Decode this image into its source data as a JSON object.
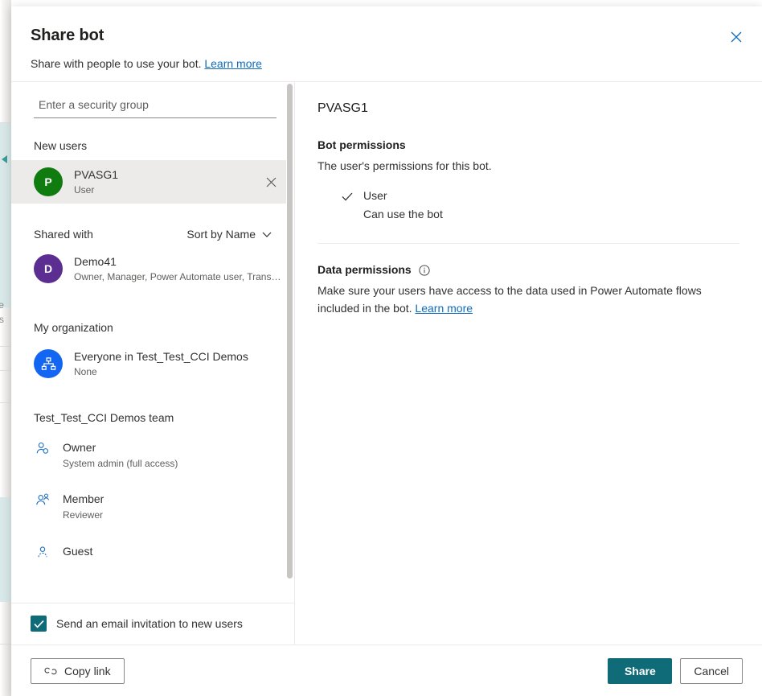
{
  "background": {
    "fragment_1": "se",
    "fragment_2": "es"
  },
  "dialog": {
    "title": "Share bot",
    "subtitle_text": "Share with people to use your bot.",
    "subtitle_link": "Learn more",
    "close_icon": "close-icon"
  },
  "left_pane": {
    "search": {
      "placeholder": "Enter a security group",
      "value": ""
    },
    "new_users": {
      "label": "New users",
      "people": [
        {
          "initial": "P",
          "name": "PVASG1",
          "sub": "User",
          "avatar_color": "#107C10",
          "selected": true,
          "remove_icon": "close-icon"
        }
      ]
    },
    "shared_with": {
      "label": "Shared with",
      "sort_label": "Sort by Name",
      "sort_icon": "chevron-down-icon",
      "people": [
        {
          "initial": "D",
          "name": "Demo41",
          "sub": "Owner, Manager, Power Automate user, Transc...",
          "avatar_color": "#5C2E91",
          "selected": false
        }
      ]
    },
    "my_organization": {
      "label": "My organization",
      "entries": [
        {
          "icon": "org-hierarchy-icon",
          "name": "Everyone in Test_Test_CCI Demos",
          "sub": "None",
          "avatar_color": "#1266F1"
        }
      ]
    },
    "team": {
      "label": "Test_Test_CCI Demos team",
      "roles": [
        {
          "icon": "person-owner-icon",
          "name": "Owner",
          "sub": "System admin (full access)"
        },
        {
          "icon": "person-member-icon",
          "name": "Member",
          "sub": "Reviewer"
        },
        {
          "icon": "person-guest-icon",
          "name": "Guest",
          "sub": ""
        }
      ]
    },
    "footer": {
      "checkbox_label": "Send an email invitation to new users",
      "checkbox_checked": true,
      "check_icon": "checkmark-icon"
    }
  },
  "right_pane": {
    "title": "PVASG1",
    "bot_permissions": {
      "heading": "Bot permissions",
      "description": "The user's permissions for this bot.",
      "options": [
        {
          "check_icon": "checkmark-icon",
          "name": "User",
          "sub": "Can use the bot",
          "selected": true
        }
      ]
    },
    "data_permissions": {
      "heading": "Data permissions",
      "info_icon": "info-icon",
      "description": "Make sure your users have access to the data used in Power Automate flows included in the bot.",
      "link": "Learn more"
    }
  },
  "footer": {
    "copy_link_label": "Copy link",
    "copy_link_icon": "link-icon",
    "share_label": "Share",
    "cancel_label": "Cancel"
  },
  "colors": {
    "primary": "#0F6B77",
    "link": "#0F6CBD",
    "selected_row": "#EDEBE9",
    "avatar_green": "#107C10",
    "avatar_purple": "#5C2E91",
    "avatar_blue": "#1266F1",
    "role_icon_blue": "#1B6EC2"
  }
}
